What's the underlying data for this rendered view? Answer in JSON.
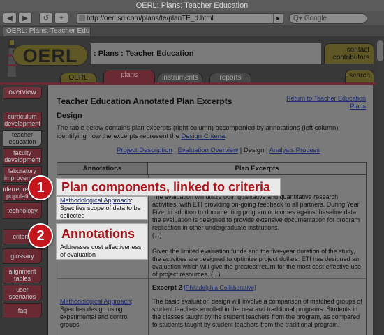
{
  "browser": {
    "title": "OERL: Plans: Teacher Education",
    "url": "http://oerl.sri.com/plans/te/planTE_d.html",
    "search_placeholder": "Google",
    "tab_label": "OERL: Plans: Teacher Educatio",
    "back_glyph": "◀",
    "forward_glyph": "▶",
    "reload_glyph": "↺",
    "add_glyph": "+",
    "search_glyph": "Q▾",
    "go_glyph": "▸"
  },
  "header": {
    "logo_text": "OERL",
    "page_title": ": Plans : Teacher Education",
    "contact": "contact",
    "contributors": "contributors"
  },
  "nav": {
    "oerl": "OERL",
    "plans": "plans",
    "instruments": "instruments",
    "reports": "reports",
    "search": "search"
  },
  "sidebar": {
    "overview": "overview",
    "items": [
      {
        "label": "curriculum development"
      },
      {
        "label": "teacher education"
      },
      {
        "label": "faculty development"
      },
      {
        "label": "laboratory improvement"
      },
      {
        "label": "underrepresented populations"
      },
      {
        "label": "technology"
      },
      {
        "label": "criteria"
      },
      {
        "label": "glossary"
      },
      {
        "label": "alignment tables"
      },
      {
        "label": "user scenarios"
      },
      {
        "label": "faq"
      }
    ]
  },
  "content": {
    "title": "Teacher Education Annotated Plan Excerpts",
    "return_link": "Return to Teacher Education Plans",
    "section": "Design",
    "intro": "The table below contains plan excerpts (right column) accompanied by annotations (left column) identifying how the excerpts represent the",
    "intro_link": "Design Criteria",
    "intro_end": ".",
    "subnav": {
      "project_description": "Project Description",
      "sep1": " | ",
      "evaluation_overview": "Evaluation Overview",
      "sep2": " | ",
      "design": "Design",
      "sep3": " | ",
      "analysis_process": "Analysis Process"
    },
    "table": {
      "col_annotations": "Annotations",
      "col_excerpts": "Plan Excerpts",
      "rows": [
        {
          "annotation_link": "Methodological Approach",
          "annotation_text": ": Specifies scope of data to be collected",
          "excerpt": "The evaluation will utilize both qualitative and quantitative research activities, with ETI providing on-going feedback to all partners. During Year Five, in addition to documenting program outcomes against baseline data, the evaluation is designed to provide extensive documentation for program replication in other undergraduate institutions.",
          "excerpt_ellipsis": "(...)"
        },
        {
          "annotation_text": "Addresses cost effectiveness of evaluation",
          "excerpt": "Given the limited evaluation funds and the five-year duration of the study, the activities are designed to optimize project dollars. ETI has designed an evaluation which will give the greatest return for the most cost-effective use of project resources. (...)"
        },
        {
          "excerpt_heading": "Excerpt 2",
          "excerpt_source": "[Philadelphia Collaborative]",
          "annotation_link": "Methodological Approach",
          "annotation_text": ": Specifies design using experimental and control groups",
          "excerpt": "The basic evaluation design will involve a comparison of matched groups of student teachers enrolled in the new and traditional programs. Students in the classes taught by the student teachers from the program, as compared to students taught by student teachers from the traditional program."
        }
      ]
    }
  },
  "callouts": [
    {
      "number": "1",
      "label": "Plan components, linked to criteria"
    },
    {
      "number": "2",
      "label": "Annotations"
    }
  ],
  "colors": {
    "accent_red": "#c4161c",
    "callout_text": "#a8141c",
    "maroon": "#6a2a34",
    "olive": "#5f5726"
  }
}
